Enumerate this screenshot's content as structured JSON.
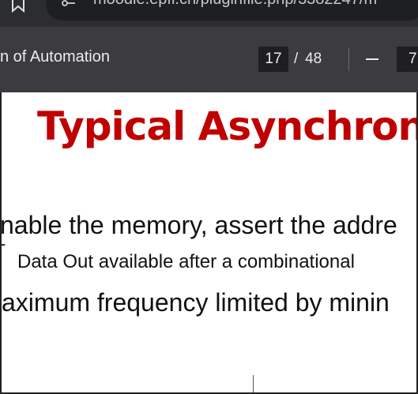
{
  "browser": {
    "url": "moodle.epfl.ch/pluginfile.php/3382247/m",
    "icons": {
      "bookmark": "bookmark-icon",
      "site_info": "tune-icon"
    }
  },
  "pdf_toolbar": {
    "title": "n of Automation",
    "current_page": "17",
    "page_separator": "/",
    "total_pages": "48",
    "zoom_value": "7",
    "icons": {
      "zoom_out": "minus-icon"
    }
  },
  "slide": {
    "title": "Typical Asynchron",
    "bullet1": "nable the memory, assert the addre",
    "bullet2_marker": "-",
    "bullet2": "Data Out available after a combinational",
    "bullet3": "aximum frequency limited by minin"
  },
  "colors": {
    "title_red": "#c00000",
    "toolbar_bg": "#3c3c3f",
    "browser_bg": "#2c2d30"
  }
}
